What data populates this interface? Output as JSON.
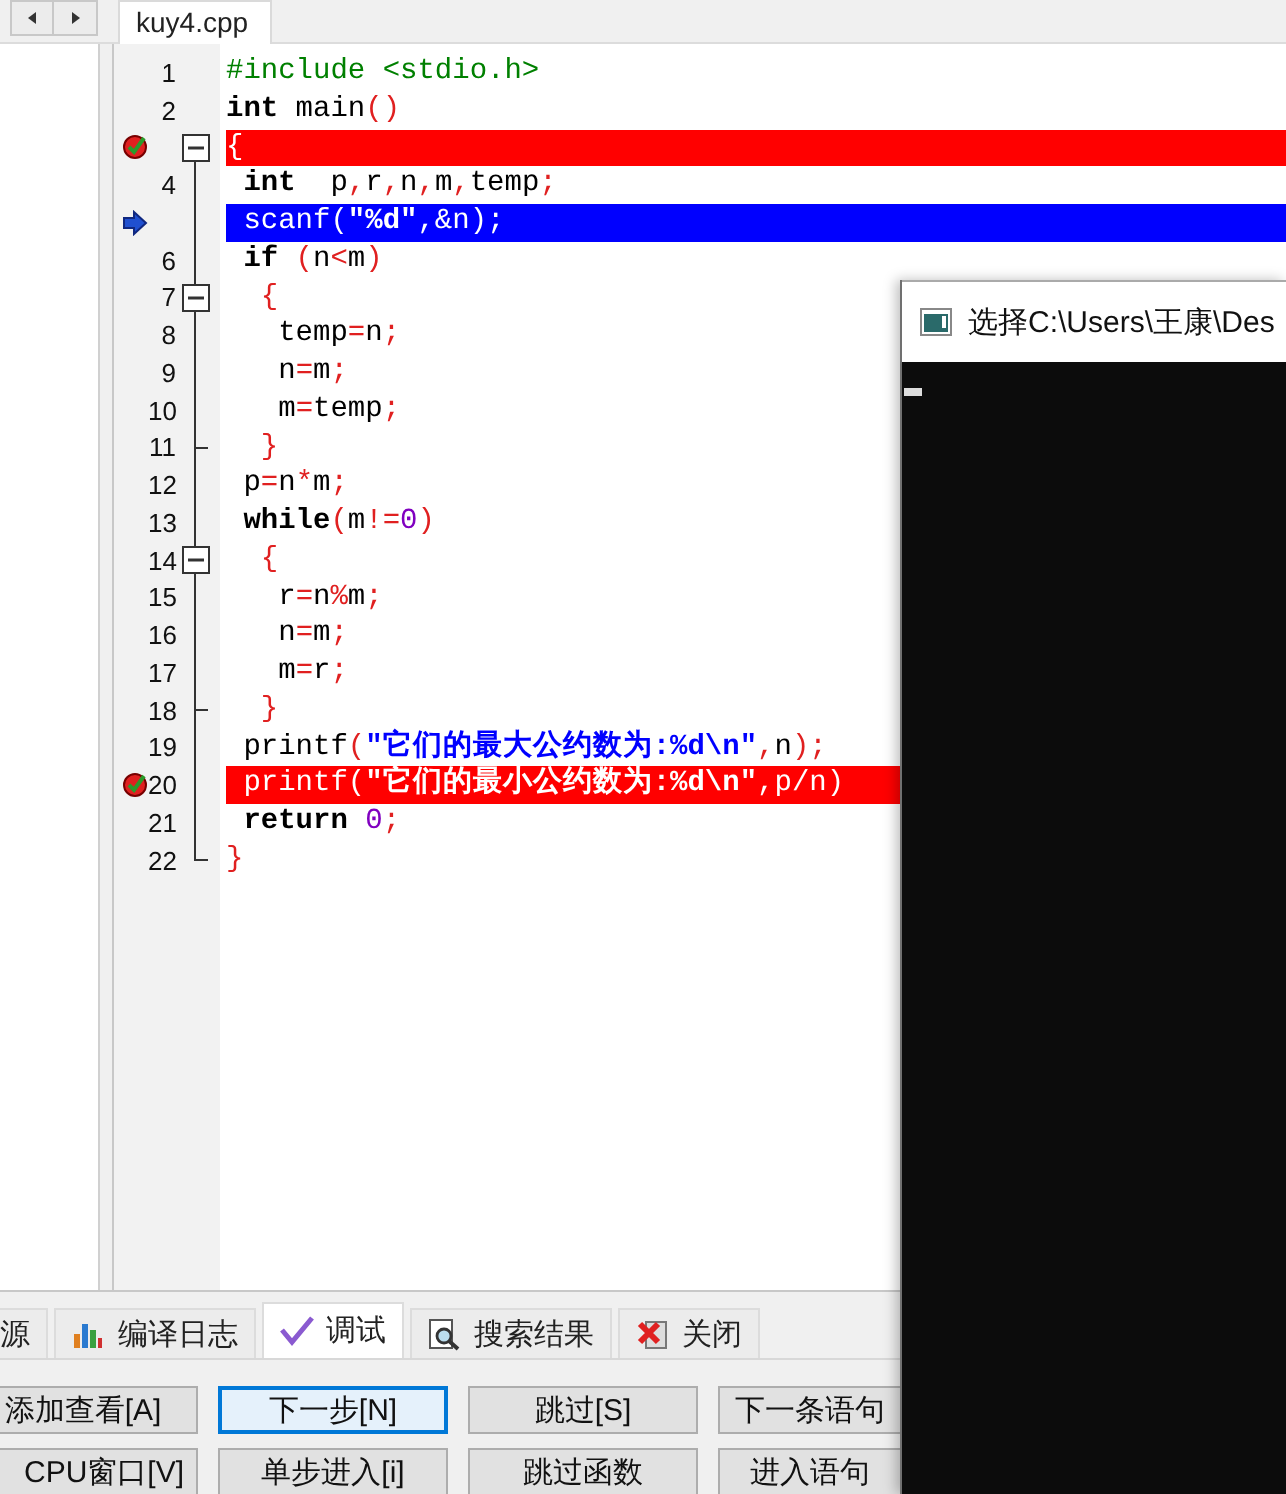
{
  "editor_tab": {
    "label": "kuy4.cpp",
    "selected": true
  },
  "code_lines": [
    {
      "number": "1",
      "kind": "code",
      "breakpoint": false,
      "current": false,
      "tokens": [
        {
          "kind": "preproc",
          "text": "#include <stdio.h>"
        }
      ]
    },
    {
      "number": "2",
      "kind": "code",
      "breakpoint": false,
      "current": false,
      "tokens": [
        {
          "kind": "keyword",
          "text": "int"
        },
        {
          "kind": "plain",
          "text": " main"
        },
        {
          "kind": "punct",
          "text": "()"
        }
      ]
    },
    {
      "kind": "fold_start",
      "breakpoint": true,
      "current": false,
      "tokens": [
        {
          "kind": "punct",
          "text": "{"
        }
      ]
    },
    {
      "number": "4",
      "kind": "code",
      "breakpoint": false,
      "current": false,
      "tokens": [
        {
          "kind": "keyword",
          "text": " int"
        },
        {
          "kind": "plain",
          "text": "  p"
        },
        {
          "kind": "punct",
          "text": ","
        },
        {
          "kind": "plain",
          "text": "r"
        },
        {
          "kind": "punct",
          "text": ","
        },
        {
          "kind": "plain",
          "text": "n"
        },
        {
          "kind": "punct",
          "text": ","
        },
        {
          "kind": "plain",
          "text": "m"
        },
        {
          "kind": "punct",
          "text": ","
        },
        {
          "kind": "plain",
          "text": "temp"
        },
        {
          "kind": "punct",
          "text": ";"
        }
      ]
    },
    {
      "kind": "code",
      "breakpoint": false,
      "current": true,
      "tokens": [
        {
          "kind": "plain",
          "text": " scanf"
        },
        {
          "kind": "punct",
          "text": "("
        },
        {
          "kind": "string",
          "text": "\"%d\""
        },
        {
          "kind": "punct",
          "text": ",&"
        },
        {
          "kind": "plain",
          "text": "n"
        },
        {
          "kind": "punct",
          "text": ");"
        }
      ]
    },
    {
      "number": "6",
      "kind": "code",
      "breakpoint": false,
      "current": false,
      "tokens": [
        {
          "kind": "keyword",
          "text": " if"
        },
        {
          "kind": "punct",
          "text": " ("
        },
        {
          "kind": "plain",
          "text": "n"
        },
        {
          "kind": "punct",
          "text": "<"
        },
        {
          "kind": "plain",
          "text": "m"
        },
        {
          "kind": "punct",
          "text": ")"
        }
      ]
    },
    {
      "number": "7",
      "kind": "fold_start",
      "breakpoint": false,
      "current": false,
      "tokens": [
        {
          "kind": "punct",
          "text": "  {"
        }
      ]
    },
    {
      "number": "8",
      "kind": "code",
      "breakpoint": false,
      "current": false,
      "tokens": [
        {
          "kind": "plain",
          "text": "   temp"
        },
        {
          "kind": "punct",
          "text": "="
        },
        {
          "kind": "plain",
          "text": "n"
        },
        {
          "kind": "punct",
          "text": ";"
        }
      ]
    },
    {
      "number": "9",
      "kind": "code",
      "breakpoint": false,
      "current": false,
      "tokens": [
        {
          "kind": "plain",
          "text": "   n"
        },
        {
          "kind": "punct",
          "text": "="
        },
        {
          "kind": "plain",
          "text": "m"
        },
        {
          "kind": "punct",
          "text": ";"
        }
      ]
    },
    {
      "number": "10",
      "kind": "code",
      "breakpoint": false,
      "current": false,
      "tokens": [
        {
          "kind": "plain",
          "text": "   m"
        },
        {
          "kind": "punct",
          "text": "="
        },
        {
          "kind": "plain",
          "text": "temp"
        },
        {
          "kind": "punct",
          "text": ";"
        }
      ]
    },
    {
      "number": "11",
      "kind": "fold_end",
      "breakpoint": false,
      "current": false,
      "tokens": [
        {
          "kind": "punct",
          "text": "  }"
        }
      ]
    },
    {
      "number": "12",
      "kind": "code",
      "breakpoint": false,
      "current": false,
      "tokens": [
        {
          "kind": "plain",
          "text": " p"
        },
        {
          "kind": "punct",
          "text": "="
        },
        {
          "kind": "plain",
          "text": "n"
        },
        {
          "kind": "punct",
          "text": "*"
        },
        {
          "kind": "plain",
          "text": "m"
        },
        {
          "kind": "punct",
          "text": ";"
        }
      ]
    },
    {
      "number": "13",
      "kind": "code",
      "breakpoint": false,
      "current": false,
      "tokens": [
        {
          "kind": "keyword",
          "text": " while"
        },
        {
          "kind": "punct",
          "text": "("
        },
        {
          "kind": "plain",
          "text": "m"
        },
        {
          "kind": "punct",
          "text": "!="
        },
        {
          "kind": "number",
          "text": "0"
        },
        {
          "kind": "punct",
          "text": ")"
        }
      ]
    },
    {
      "number": "14",
      "kind": "fold_start",
      "breakpoint": false,
      "current": false,
      "tokens": [
        {
          "kind": "punct",
          "text": "  {"
        }
      ]
    },
    {
      "number": "15",
      "kind": "code",
      "breakpoint": false,
      "current": false,
      "tokens": [
        {
          "kind": "plain",
          "text": "   r"
        },
        {
          "kind": "punct",
          "text": "="
        },
        {
          "kind": "plain",
          "text": "n"
        },
        {
          "kind": "punct",
          "text": "%"
        },
        {
          "kind": "plain",
          "text": "m"
        },
        {
          "kind": "punct",
          "text": ";"
        }
      ]
    },
    {
      "number": "16",
      "kind": "code",
      "breakpoint": false,
      "current": false,
      "tokens": [
        {
          "kind": "plain",
          "text": "   n"
        },
        {
          "kind": "punct",
          "text": "="
        },
        {
          "kind": "plain",
          "text": "m"
        },
        {
          "kind": "punct",
          "text": ";"
        }
      ]
    },
    {
      "number": "17",
      "kind": "code",
      "breakpoint": false,
      "current": false,
      "tokens": [
        {
          "kind": "plain",
          "text": "   m"
        },
        {
          "kind": "punct",
          "text": "="
        },
        {
          "kind": "plain",
          "text": "r"
        },
        {
          "kind": "punct",
          "text": ";"
        }
      ]
    },
    {
      "number": "18",
      "kind": "fold_end",
      "breakpoint": false,
      "current": false,
      "tokens": [
        {
          "kind": "punct",
          "text": "  }"
        }
      ]
    },
    {
      "number": "19",
      "kind": "code",
      "breakpoint": false,
      "current": false,
      "tokens": [
        {
          "kind": "plain",
          "text": " printf"
        },
        {
          "kind": "punct",
          "text": "("
        },
        {
          "kind": "string",
          "text": "\"它们的最大公约数为:%d\\n\""
        },
        {
          "kind": "punct",
          "text": ","
        },
        {
          "kind": "plain",
          "text": "n"
        },
        {
          "kind": "punct",
          "text": ");"
        }
      ]
    },
    {
      "number": "20",
      "kind": "code",
      "breakpoint": true,
      "current": false,
      "tokens": [
        {
          "kind": "plain",
          "text": " printf"
        },
        {
          "kind": "punct",
          "text": "("
        },
        {
          "kind": "string",
          "text": "\"它们的最小公约数为:%d\\n\""
        },
        {
          "kind": "punct",
          "text": ","
        },
        {
          "kind": "plain",
          "text": "p"
        },
        {
          "kind": "punct",
          "text": "/"
        },
        {
          "kind": "plain",
          "text": "n"
        },
        {
          "kind": "punct",
          "text": ")"
        }
      ]
    },
    {
      "number": "21",
      "kind": "code",
      "breakpoint": false,
      "current": false,
      "tokens": [
        {
          "kind": "keyword",
          "text": " return"
        },
        {
          "kind": "number",
          "text": " 0"
        },
        {
          "kind": "punct",
          "text": ";"
        }
      ]
    },
    {
      "number": "22",
      "kind": "fold_end",
      "breakpoint": false,
      "current": false,
      "tokens": [
        {
          "kind": "punct",
          "text": "}"
        }
      ]
    }
  ],
  "bottom_tabs": [
    {
      "label": "源",
      "selected": false
    },
    {
      "label": "编译日志",
      "selected": false
    },
    {
      "label": "调试",
      "selected": true
    },
    {
      "label": "搜索结果",
      "selected": false
    },
    {
      "label": "关闭",
      "selected": false
    }
  ],
  "debug_buttons": [
    [
      {
        "label": "添加查看[A]",
        "focused": false
      },
      {
        "label": "下一步[N]",
        "focused": true
      },
      {
        "label": "跳过[S]",
        "focused": false
      },
      {
        "label": "下一条语句",
        "focused": false
      }
    ],
    [
      {
        "label": "CPU窗口[V]",
        "focused": false
      },
      {
        "label": "单步进入[i]",
        "focused": false
      },
      {
        "label": "跳过函数",
        "focused": false
      },
      {
        "label": "进入语句",
        "focused": false
      }
    ]
  ],
  "console_window": {
    "title": "选择C:\\Users\\王康\\Des"
  }
}
